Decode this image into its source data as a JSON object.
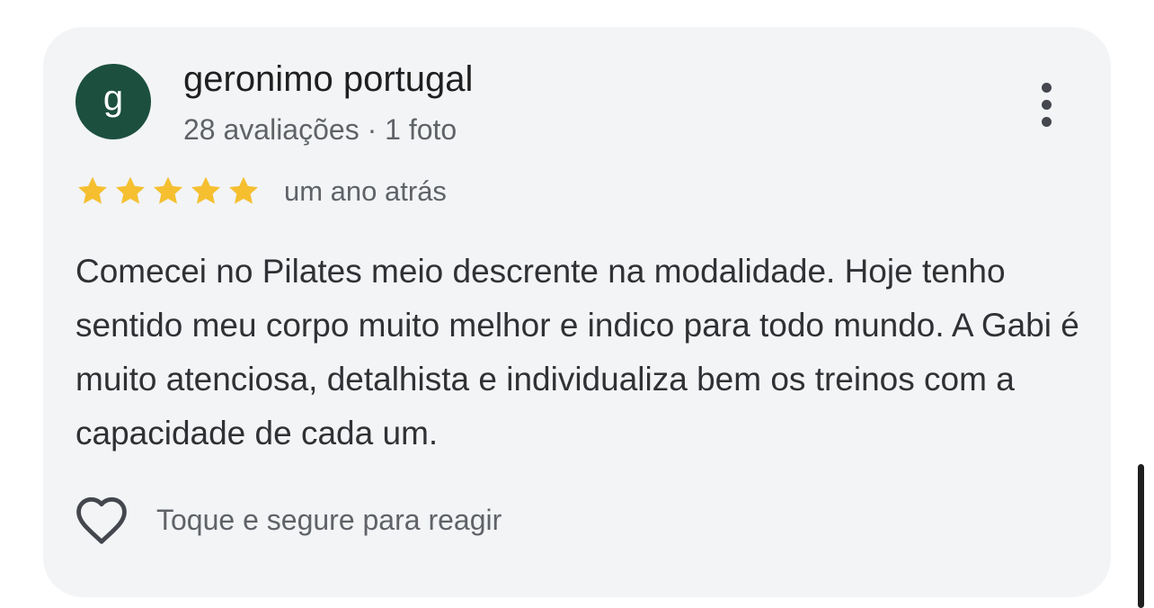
{
  "review": {
    "avatar_letter": "g",
    "avatar_color": "#1c4f3e",
    "author_name": "geronimo portugal",
    "author_meta": "28 avaliações · 1 foto",
    "rating": 5,
    "rating_max": 5,
    "star_color": "#f5bf30",
    "date": "um ano atrás",
    "text": "Comecei no Pilates meio descrente na modalidade. Hoje tenho sentido meu corpo muito melhor e indico para todo mundo. A Gabi é muito atenciosa, detalhista e individualiza bem os treinos com a capacidade de cada um.",
    "more_icon": "more-vert-icon",
    "react_icon": "heart-outline-icon",
    "react_label": "Toque e segure para reagir"
  }
}
